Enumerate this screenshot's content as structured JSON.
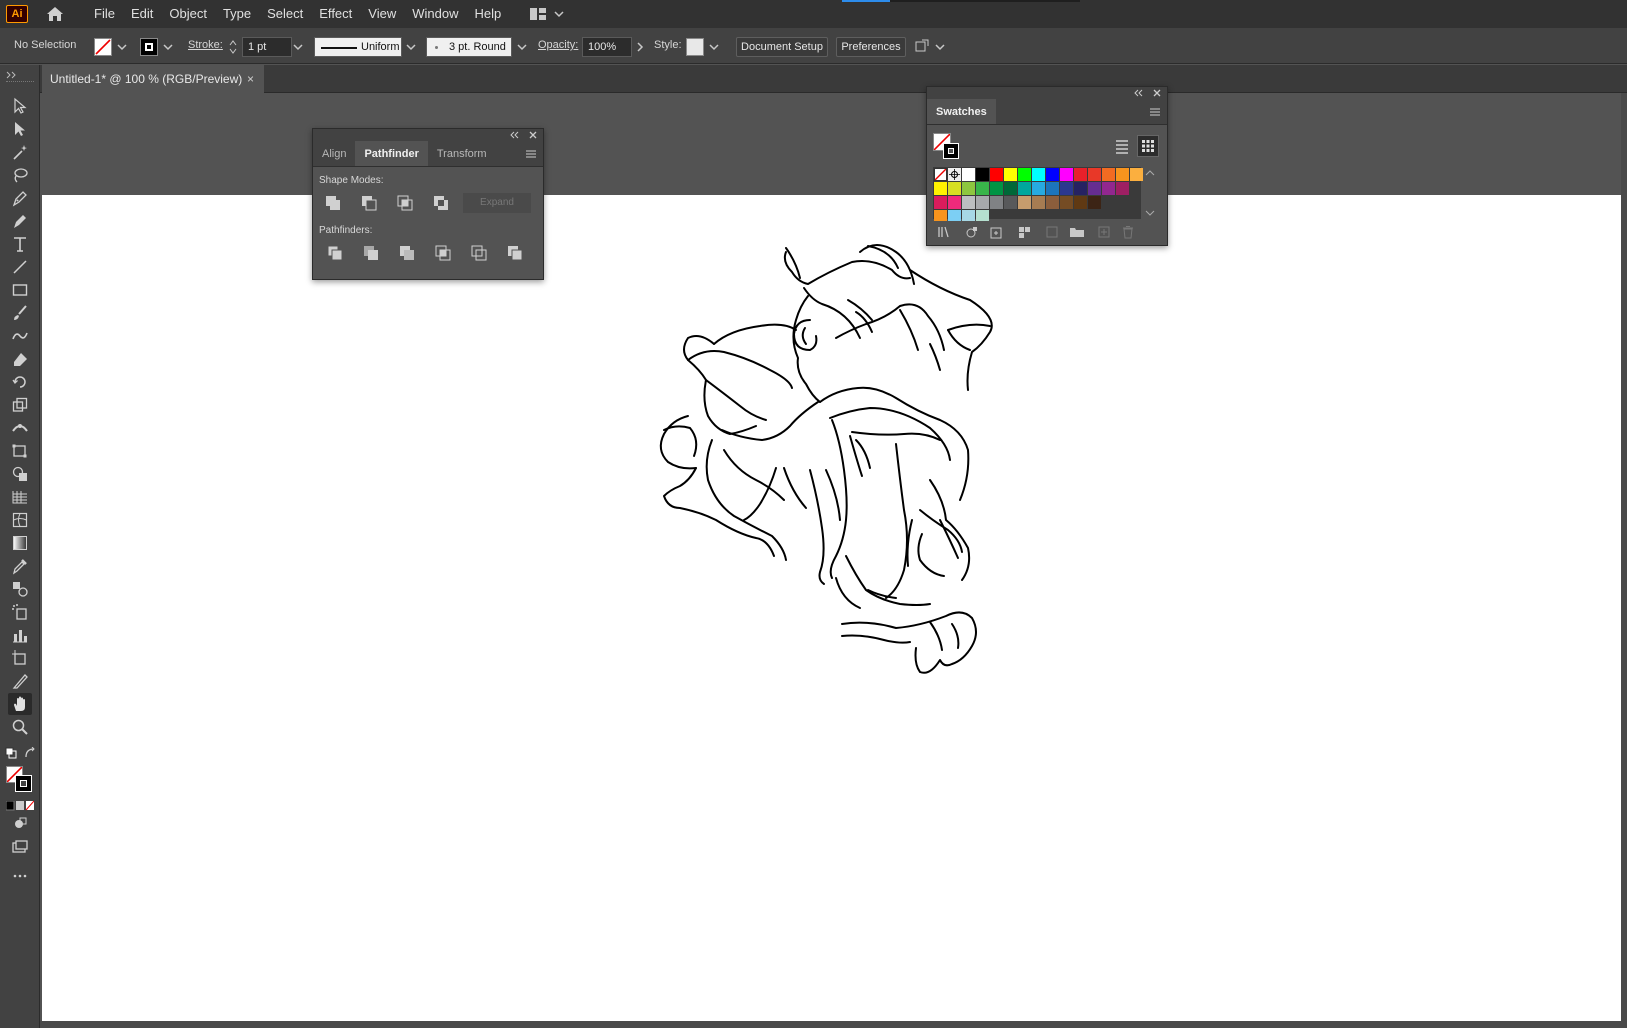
{
  "app": {
    "logo": "Ai"
  },
  "menu": {
    "items": [
      "File",
      "Edit",
      "Object",
      "Type",
      "Select",
      "Effect",
      "View",
      "Window",
      "Help"
    ]
  },
  "control": {
    "selection": "No Selection",
    "stroke_label": "Stroke:",
    "stroke_value": "1 pt",
    "profile": "Uniform",
    "brush": "3 pt. Round",
    "opacity_label": "Opacity:",
    "opacity_value": "100%",
    "style_label": "Style:",
    "document_setup": "Document Setup",
    "preferences": "Preferences"
  },
  "document": {
    "tab_title": "Untitled-1* @ 100 % (RGB/Preview)",
    "close": "×"
  },
  "pathfinder_panel": {
    "tabs": [
      "Align",
      "Pathfinder",
      "Transform"
    ],
    "active_tab": "Pathfinder",
    "shape_modes_label": "Shape Modes:",
    "expand_label": "Expand",
    "pathfinders_label": "Pathfinders:"
  },
  "swatches_panel": {
    "title": "Swatches",
    "colors_row1": [
      "#ffffff",
      "#000000",
      "#ff0000",
      "#ffff00",
      "#00ff00",
      "#00ffff",
      "#0000ff",
      "#ff00ff",
      "#e8202a",
      "#e83828",
      "#f26b22",
      "#f7941d",
      "#fbaf3f"
    ],
    "colors_row2": [
      "#fff200",
      "#d7df23",
      "#8dc63f",
      "#39b54a",
      "#009444",
      "#006838",
      "#00a79d",
      "#27aae1",
      "#1c75bc",
      "#2b388f",
      "#262262",
      "#662d91",
      "#92278f",
      "#9e1f63"
    ],
    "colors_row3": [
      "#da1c5c",
      "#ee2a7b",
      "#bcbec0",
      "#a7a9ac",
      "#808285",
      "#58595b",
      "#c69c6d",
      "#a67c52",
      "#8b5e3c",
      "#754c24",
      "#603913",
      "#3c2415"
    ],
    "colors_row4": [
      "#f7941d",
      "#7ccff4",
      "#a7d8e5",
      "#b5e0cf"
    ]
  },
  "colors": {
    "menubar_bg": "#323232",
    "controlbar_bg": "#424242",
    "workspace_bg": "#535353",
    "artboard_bg": "#ffffff",
    "accent": "#2d8ceb",
    "logo_orange": "#ff9a00"
  }
}
